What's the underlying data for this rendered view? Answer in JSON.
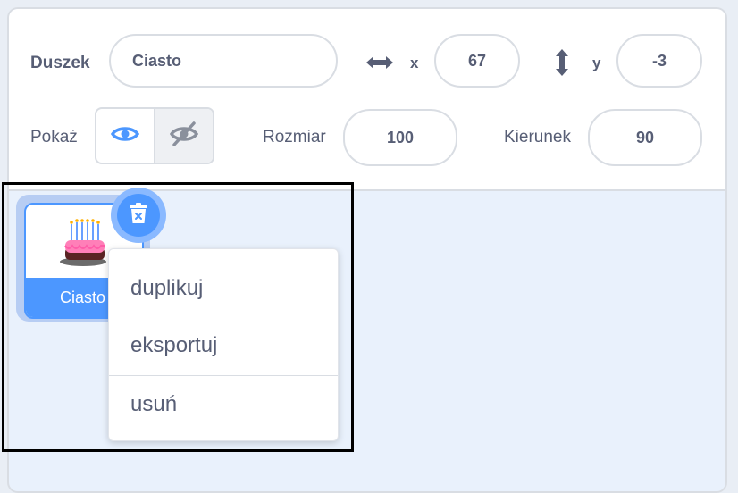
{
  "sprite_info": {
    "sprite_label": "Duszek",
    "sprite_name": "Ciasto",
    "x_label": "x",
    "x_value": "67",
    "y_label": "y",
    "y_value": "-3",
    "show_label": "Pokaż",
    "size_label": "Rozmiar",
    "size_value": "100",
    "direction_label": "Kierunek",
    "direction_value": "90",
    "icons": {
      "x_axis": "horizontal-arrows-icon",
      "y_axis": "vertical-arrows-icon",
      "show": "eye-icon",
      "hide": "eye-slash-icon"
    }
  },
  "sprite_list": {
    "items": [
      {
        "label": "Ciasto",
        "icon": "cake-icon",
        "selected": true
      }
    ],
    "delete_icon": "trash-icon"
  },
  "context_menu": {
    "items": [
      {
        "label": "duplikuj"
      },
      {
        "label": "eksportuj"
      },
      {
        "label": "usuń"
      }
    ]
  },
  "colors": {
    "accent": "#4c97ff",
    "text": "#575e75",
    "border": "#d9dde3",
    "panel_bg": "#e9f1fc"
  }
}
